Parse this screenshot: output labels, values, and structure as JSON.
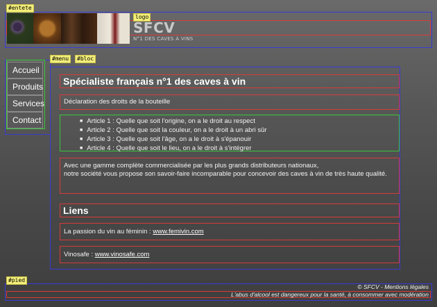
{
  "tags": {
    "entete": "#entete",
    "logo": "logo",
    "menu": "#menu",
    "bloc": "#bloc",
    "pied": "#pied"
  },
  "header": {
    "logo_title": "SFCV",
    "logo_subtitle": "N°1 DES CAVES À VINS"
  },
  "menu": {
    "items": [
      {
        "label": "Accueil"
      },
      {
        "label": "Produits"
      },
      {
        "label": "Services"
      },
      {
        "label": "Contact"
      }
    ]
  },
  "bloc": {
    "title": "Spécialiste français n°1 des caves à vin",
    "declaration": "Déclaration des droits de la bouteille",
    "articles": [
      "Article 1 : Quelle que soit l'origine, on a le droit au respect",
      "Article 2 : Quelle que soit la couleur, on a le droit à un abri sûr",
      "Article 3 : Quelle que soit l'âge, on a le droit à s'épanouir",
      "Article 4 : Quelle que soit le lieu, on a le droit à s'intégrer"
    ],
    "paragraph_1": "Avec une gamme complète commercialisée par les plus grands distributeurs nationaux,",
    "paragraph_2": "notre société vous propose son savoir-faire incomparable pour concevoir des caves à vin de très haute qualité.",
    "links_title": "Liens",
    "link_1_prefix": "La passion du vin au féminin : ",
    "link_1_text": "www.femivin.com",
    "link_2_prefix": "Vinosafe : ",
    "link_2_text": "www.vinosafe.com"
  },
  "footer": {
    "line_1": "© SFCV - Mentions légales",
    "line_2": "L'abus d'alcool est dangereux pour la santé, à consommer avec modération"
  }
}
